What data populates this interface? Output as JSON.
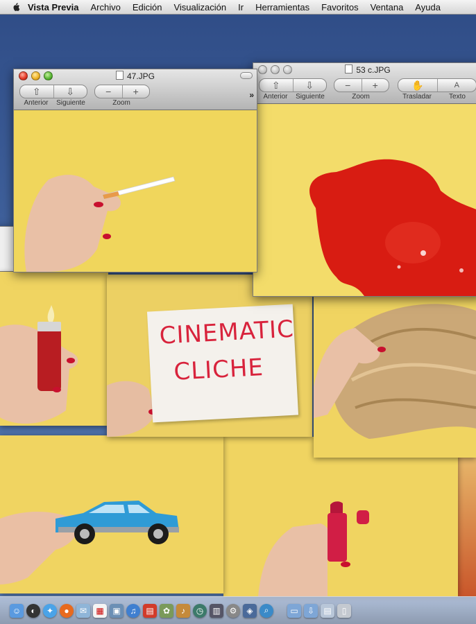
{
  "menubar": {
    "app_name": "Vista Previa",
    "items": [
      "Archivo",
      "Edición",
      "Visualización",
      "Ir",
      "Herramientas",
      "Favoritos",
      "Ventana",
      "Ayuda"
    ]
  },
  "window_left": {
    "title": "47.JPG",
    "toolbar": {
      "prev_label": "Anterior",
      "next_label": "Siguiente",
      "zoom_label": "Zoom",
      "more_glyph": "»"
    }
  },
  "window_right": {
    "title": "53 c.JPG",
    "toolbar": {
      "prev_label": "Anterior",
      "next_label": "Siguiente",
      "zoom_label": "Zoom",
      "pan_label": "Trasladar",
      "text_label": "Texto"
    }
  },
  "photo_card": {
    "line1": "CINEMATIC",
    "line2": "CLICHE"
  },
  "colors": {
    "photo_yellow": "#f0d461",
    "ketchup_red": "#d81c12",
    "nail_red": "#c8102e",
    "car_blue": "#2f9bd6"
  },
  "dock": {
    "icons": [
      "finder-icon",
      "dashboard-icon",
      "safari-icon",
      "firefox-icon",
      "mail-icon",
      "ical-icon",
      "photo-icon",
      "itunes-icon",
      "preview-icon",
      "iphoto-icon",
      "garageband-icon",
      "timemachine-icon",
      "apps-icon",
      "folder-icon",
      "downloads-icon",
      "trash-icon"
    ]
  }
}
